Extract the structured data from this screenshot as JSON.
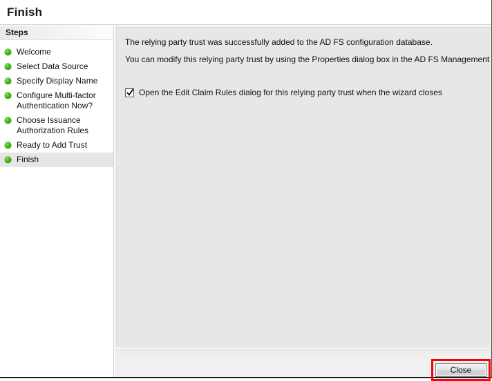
{
  "window": {
    "title": "Finish"
  },
  "sidebar": {
    "header": "Steps",
    "items": [
      {
        "label": "Welcome",
        "state": "done"
      },
      {
        "label": "Select Data Source",
        "state": "done"
      },
      {
        "label": "Specify Display Name",
        "state": "done"
      },
      {
        "label": "Configure Multi-factor\nAuthentication Now?",
        "state": "done"
      },
      {
        "label": "Choose Issuance\nAuthorization Rules",
        "state": "done"
      },
      {
        "label": "Ready to Add Trust",
        "state": "done"
      },
      {
        "label": "Finish",
        "state": "current"
      }
    ]
  },
  "content": {
    "paragraph1": "The relying party trust was successfully added to the AD FS configuration database.",
    "paragraph2": "You can modify this relying party trust by using the Properties dialog box in the AD FS Management snap-in.",
    "checkbox": {
      "label": "Open the Edit Claim Rules dialog for this relying party trust when the wizard closes",
      "checked": true
    }
  },
  "footer": {
    "close_label": "Close"
  },
  "colors": {
    "highlight_box": "#ff0000",
    "step_bullet": "#3ebf12",
    "current_step_bg": "#e6e6e6",
    "content_bg": "#e7e7e7",
    "footer_bg": "#f0f0f0"
  }
}
